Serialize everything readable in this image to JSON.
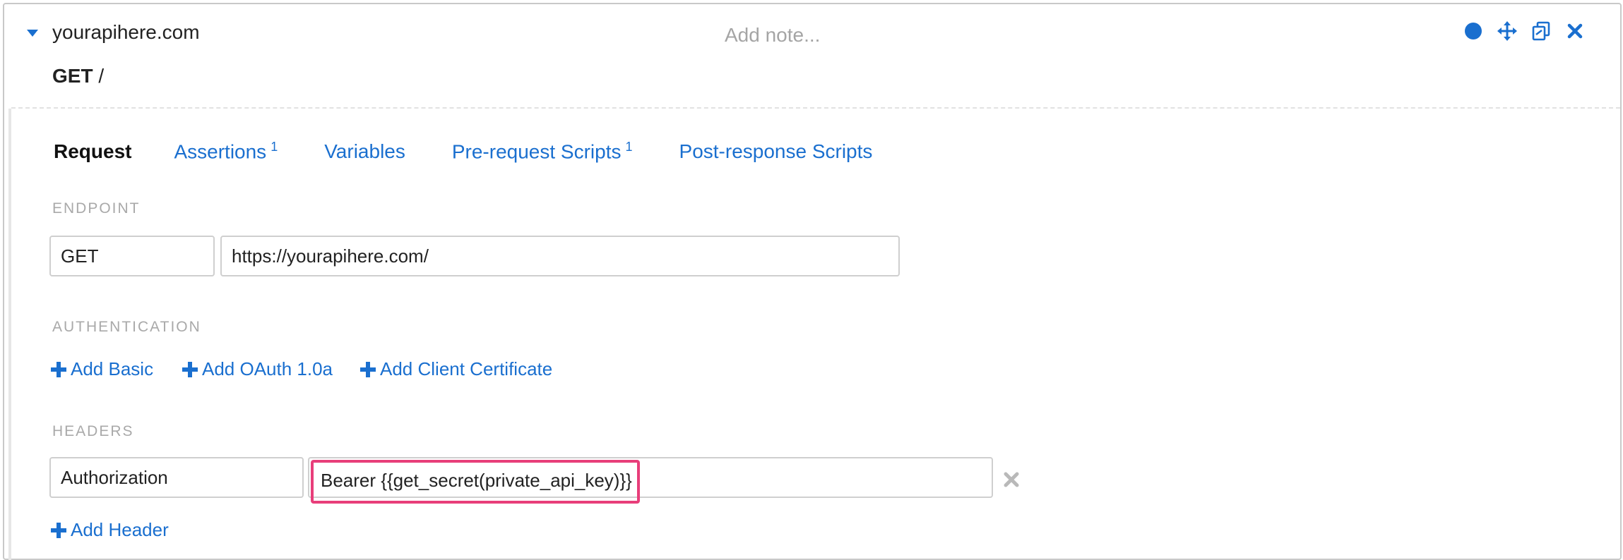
{
  "header": {
    "domain": "yourapihere.com",
    "note_placeholder": "Add note...",
    "method": "GET",
    "path": "/",
    "icons": [
      "status-dot-icon",
      "move-icon",
      "duplicate-icon",
      "close-icon"
    ],
    "accent_color": "#1a6fcf"
  },
  "tabs": [
    {
      "label": "Request",
      "badge": ""
    },
    {
      "label": "Assertions",
      "badge": "1"
    },
    {
      "label": "Variables",
      "badge": ""
    },
    {
      "label": "Pre-request Scripts",
      "badge": "1"
    },
    {
      "label": "Post-response Scripts",
      "badge": ""
    }
  ],
  "endpoint": {
    "label": "ENDPOINT",
    "method": "GET",
    "url": "https://yourapihere.com/"
  },
  "authentication": {
    "label": "AUTHENTICATION",
    "actions": [
      "Add Basic",
      "Add OAuth 1.0a",
      "Add Client Certificate"
    ]
  },
  "headers": {
    "label": "HEADERS",
    "rows": [
      {
        "name": "Authorization",
        "value": "Bearer {{get_secret(private_api_key)}}"
      }
    ],
    "add_label": "Add Header",
    "highlight_color": "#e83e7a"
  }
}
